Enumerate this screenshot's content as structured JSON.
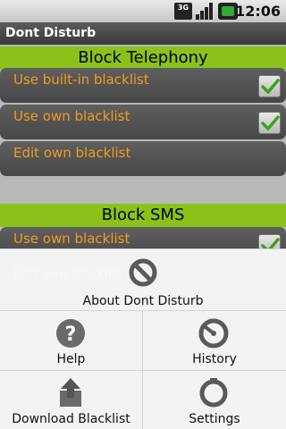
{
  "status_bar": {
    "network": "3G",
    "time": "12:06"
  },
  "app": {
    "title": "Dont Disturb"
  },
  "sections": [
    {
      "header": "Block Telephony",
      "rows": [
        {
          "label": "Use built-in blacklist",
          "checked": true
        },
        {
          "label": "Use own blacklist",
          "checked": true
        },
        {
          "label": "Edit own blacklist",
          "checked": false
        }
      ]
    },
    {
      "header": "Block SMS",
      "rows": [
        {
          "label": "Use own blacklist",
          "checked": true
        }
      ]
    }
  ],
  "menu": {
    "about": "About Dont Disturb",
    "help": "Help",
    "history": "History",
    "download": "Download Blacklist",
    "settings": "Settings"
  },
  "colors": {
    "accent_green": "#8ac21a",
    "label_orange": "#f39a1d"
  }
}
